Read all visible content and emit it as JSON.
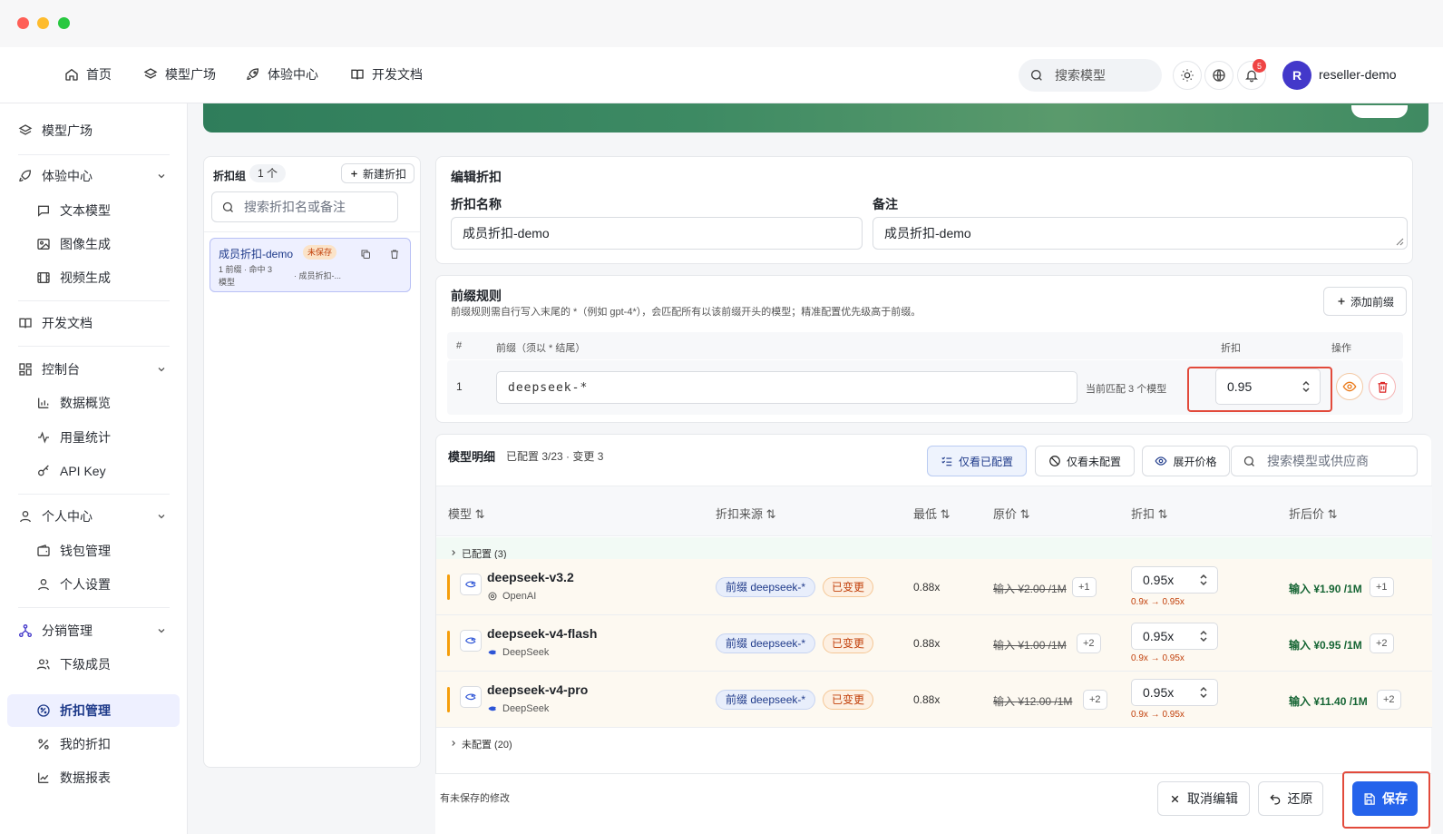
{
  "topnav": {
    "items": [
      {
        "label": "首页",
        "icon": "home-icon"
      },
      {
        "label": "模型广场",
        "icon": "layers-icon"
      },
      {
        "label": "体验中心",
        "icon": "rocket-icon"
      },
      {
        "label": "开发文档",
        "icon": "book-icon"
      }
    ],
    "search_placeholder": "搜索模型",
    "notification_count": "5",
    "avatar_letter": "R",
    "username": "reseller-demo"
  },
  "sidebar": {
    "items": [
      {
        "label": "模型广场"
      },
      {
        "label": "体验中心"
      },
      {
        "label": "文本模型"
      },
      {
        "label": "图像生成"
      },
      {
        "label": "视频生成"
      },
      {
        "label": "开发文档"
      },
      {
        "label": "控制台"
      },
      {
        "label": "数据概览"
      },
      {
        "label": "用量统计"
      },
      {
        "label": "API Key"
      },
      {
        "label": "个人中心"
      },
      {
        "label": "钱包管理"
      },
      {
        "label": "个人设置"
      },
      {
        "label": "分销管理"
      },
      {
        "label": "下级成员"
      },
      {
        "label": "折扣管理"
      },
      {
        "label": "我的折扣"
      },
      {
        "label": "数据报表"
      }
    ],
    "active": "折扣管理"
  },
  "groups": {
    "title": "折扣组",
    "count": "1 个",
    "new_button": "新建折扣",
    "search_placeholder": "搜索折扣名或备注",
    "item": {
      "name": "成员折扣-demo",
      "badge": "未保存",
      "meta1": "1 前缀 · 命中 3",
      "meta2": "模型",
      "note": "· 成员折扣-..."
    }
  },
  "edit": {
    "title": "编辑折扣",
    "name_label": "折扣名称",
    "name_value": "成员折扣-demo",
    "note_label": "备注",
    "note_value": "成员折扣-demo"
  },
  "prefix": {
    "title": "前缀规则",
    "desc": "前缀规则需自行写入末尾的 *（例如 gpt-4*），会匹配所有以该前缀开头的模型；精准配置优先级高于前缀。",
    "add_button": "添加前缀",
    "col_index": "#",
    "col_prefix": "前缀（须以 * 结尾）",
    "col_discount": "折扣",
    "col_action": "操作",
    "row": {
      "index": "1",
      "prefix": "deepseek-*",
      "match": "当前匹配 3 个模型",
      "discount": "0.95"
    }
  },
  "models": {
    "title": "模型明细",
    "summary": "已配置 3/23 · 变更 3",
    "btn_only_configured": "仅看已配置",
    "btn_only_unconfigured": "仅看未配置",
    "btn_expand_price": "展开价格",
    "search_placeholder": "搜索模型或供应商",
    "columns": [
      "模型",
      "折扣来源",
      "最低",
      "原价",
      "折扣",
      "折后价"
    ],
    "group_configured": "已配置 (3)",
    "group_unconfigured": "未配置 (20)",
    "rows": [
      {
        "name": "deepseek-v3.2",
        "vendor": "OpenAI",
        "source": "前缀 deepseek-*",
        "state": "已变更",
        "low": "0.88x",
        "orig": "输入 ¥2.00 /1M",
        "orig_more": "+1",
        "discount": "0.95x",
        "change": "0.9x → 0.95x",
        "final": "输入 ¥1.90 /1M",
        "final_more": "+1"
      },
      {
        "name": "deepseek-v4-flash",
        "vendor": "DeepSeek",
        "source": "前缀 deepseek-*",
        "state": "已变更",
        "low": "0.88x",
        "orig": "输入 ¥1.00 /1M",
        "orig_more": "+2",
        "discount": "0.95x",
        "change": "0.9x → 0.95x",
        "final": "输入 ¥0.95 /1M",
        "final_more": "+2"
      },
      {
        "name": "deepseek-v4-pro",
        "vendor": "DeepSeek",
        "source": "前缀 deepseek-*",
        "state": "已变更",
        "low": "0.88x",
        "orig": "输入 ¥12.00 /1M",
        "orig_more": "+2",
        "discount": "0.95x",
        "change": "0.9x → 0.95x",
        "final": "输入 ¥11.40 /1M",
        "final_more": "+2"
      }
    ]
  },
  "footer": {
    "unsaved": "有未保存的修改",
    "cancel": "取消编辑",
    "restore": "还原",
    "save": "保存"
  },
  "colors": {
    "accent": "#2563eb",
    "active_bg": "#eef0ff",
    "changed": "#c2410c",
    "final_price": "#166534",
    "highlight": "#e24a3b"
  }
}
